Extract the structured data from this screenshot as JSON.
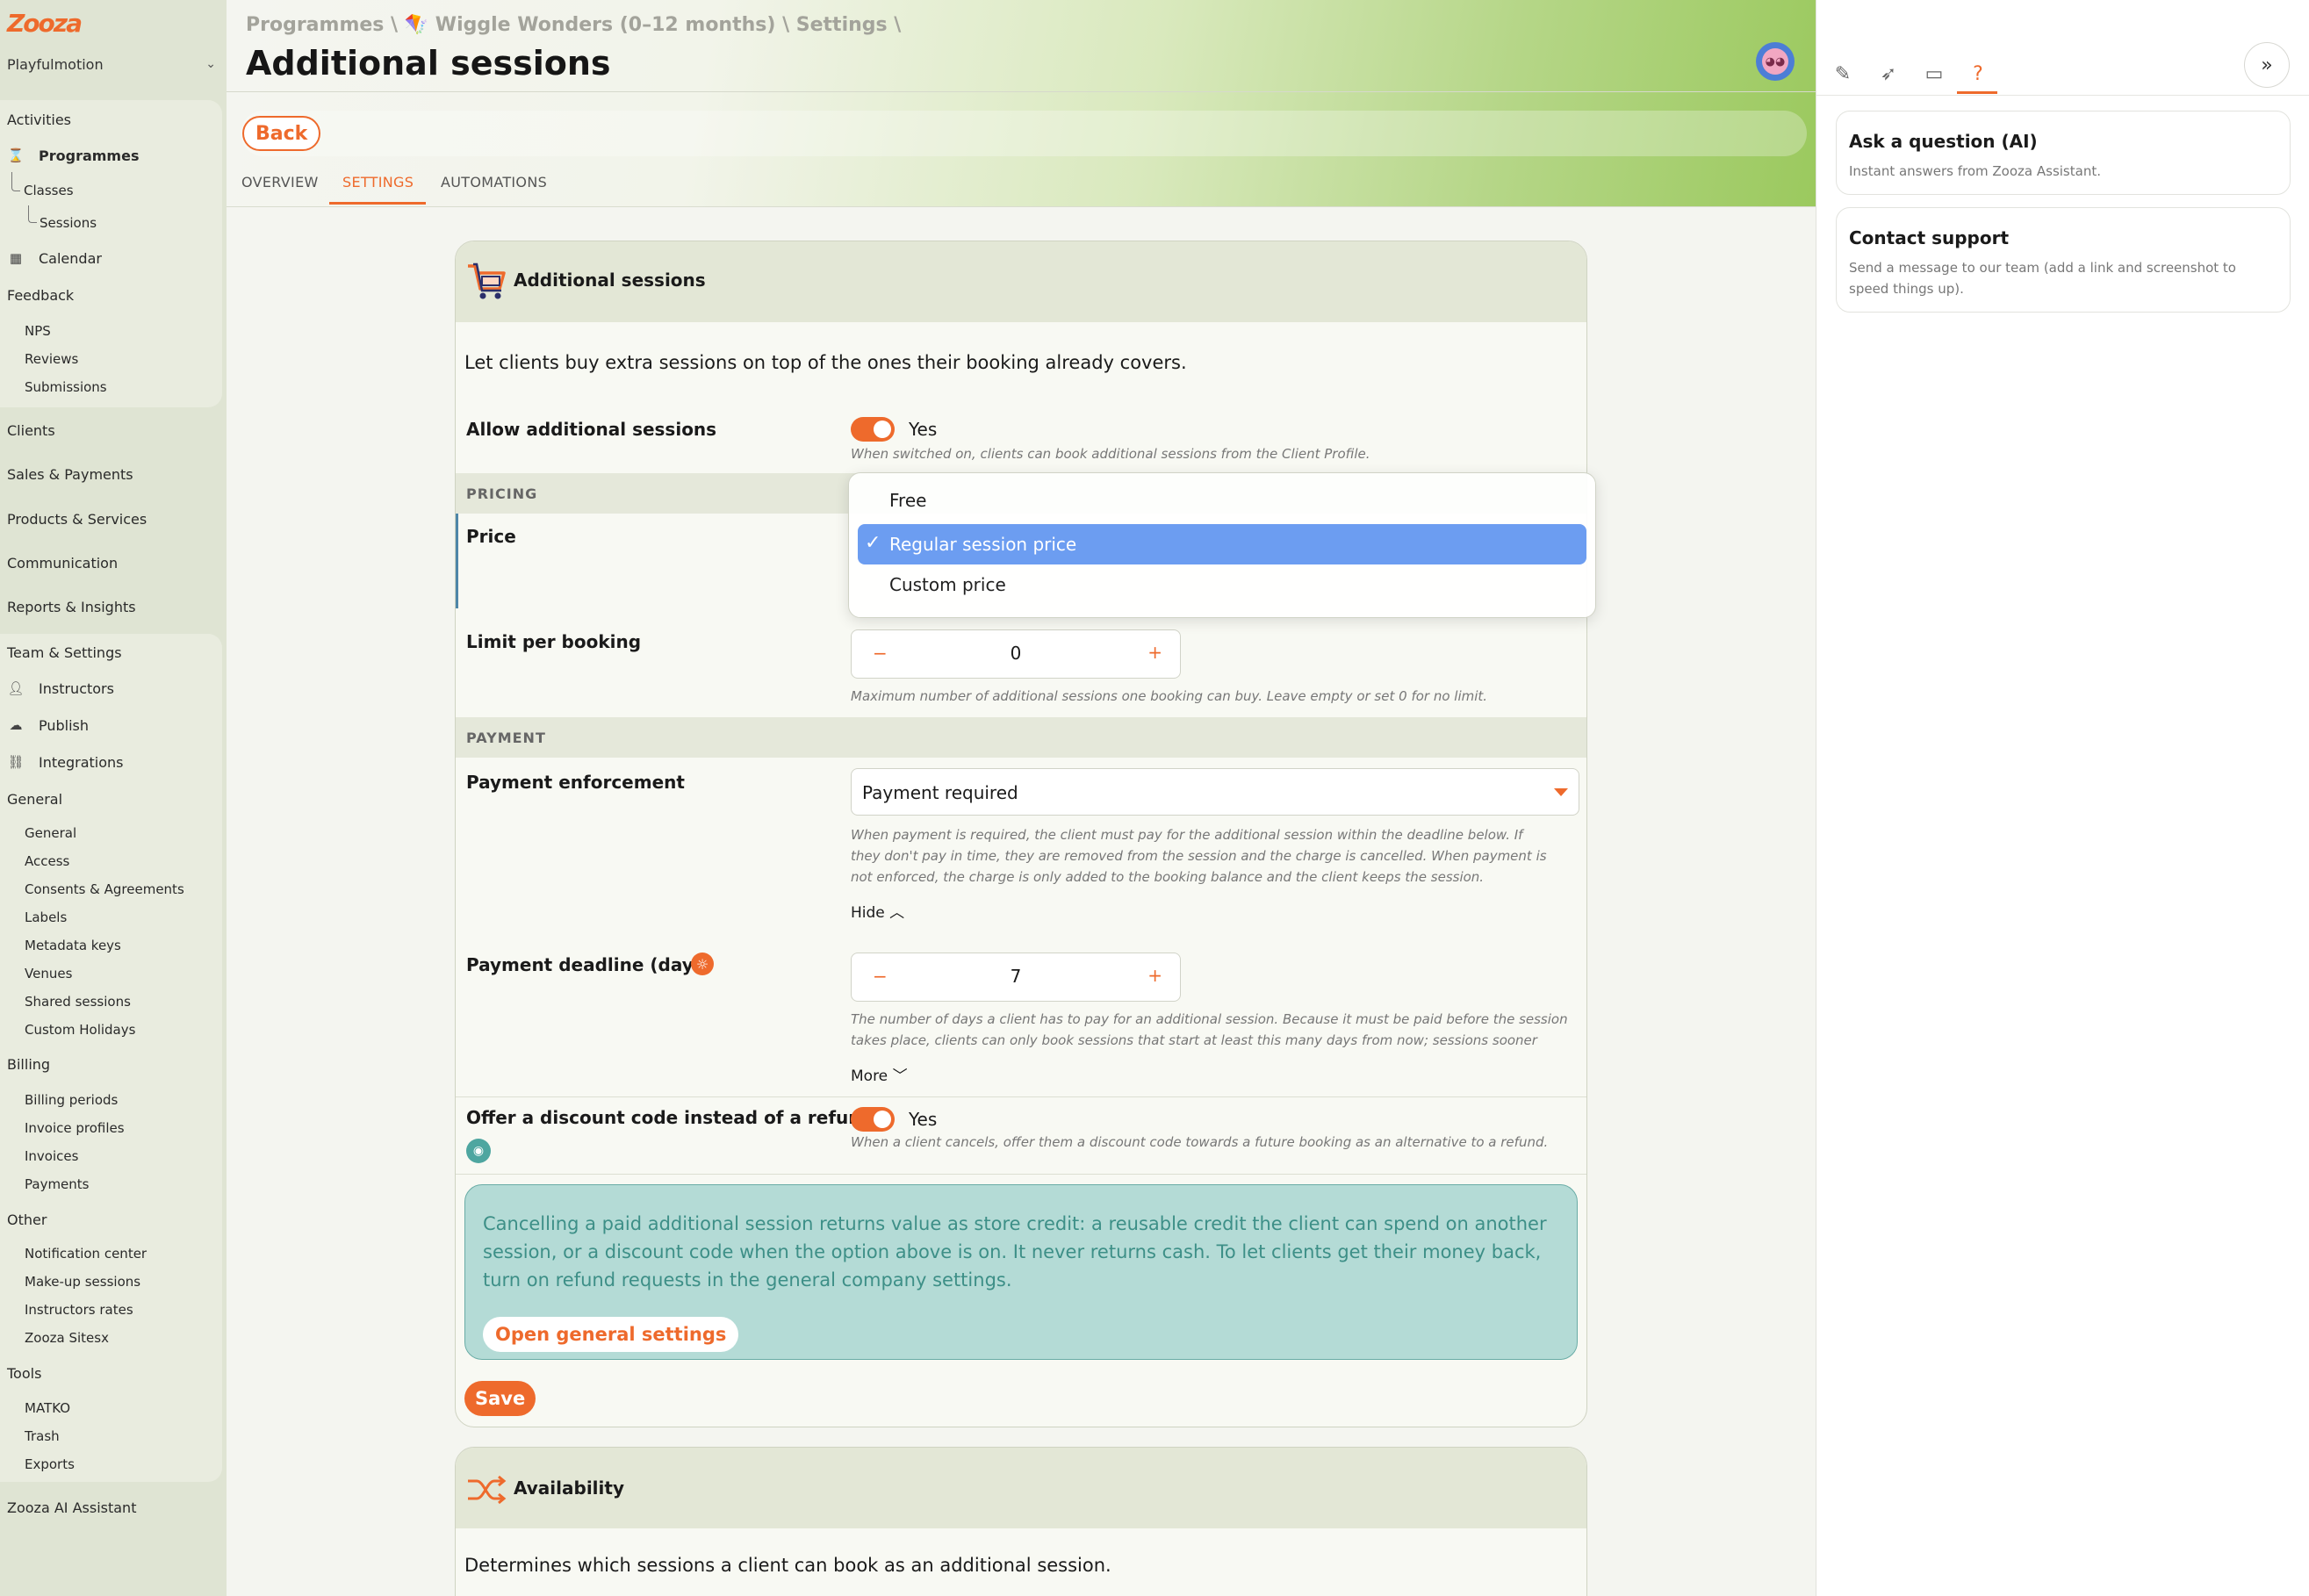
{
  "sidebar": {
    "logo": "Zooza",
    "org": "Playfulmotion",
    "items": {
      "activities": "Activities",
      "programmes": "Programmes",
      "classes": "Classes",
      "sessions": "Sessions",
      "calendar": "Calendar",
      "feedback": "Feedback",
      "nps": "NPS",
      "reviews": "Reviews",
      "submissions": "Submissions",
      "clients": "Clients",
      "sales_payments": "Sales & Payments",
      "products_services": "Products & Services",
      "communication": "Communication",
      "reports_insights": "Reports & Insights",
      "team_settings": "Team & Settings",
      "instructors": "Instructors",
      "publish": "Publish",
      "integrations": "Integrations",
      "general_header": "General",
      "general": "General",
      "access": "Access",
      "consents": "Consents & Agreements",
      "labels": "Labels",
      "metadata_keys": "Metadata keys",
      "venues": "Venues",
      "shared_sessions": "Shared sessions",
      "custom_holidays": "Custom Holidays",
      "billing": "Billing",
      "billing_periods": "Billing periods",
      "invoice_profiles": "Invoice profiles",
      "invoices": "Invoices",
      "payments": "Payments",
      "other": "Other",
      "notification_center": "Notification center",
      "makeup_sessions": "Make-up sessions",
      "instructors_rates": "Instructors rates",
      "zooza_sitesx": "Zooza Sitesx",
      "tools": "Tools",
      "matko": "MATKO",
      "trash": "Trash",
      "exports": "Exports",
      "ai_assistant": "Zooza AI Assistant"
    }
  },
  "header": {
    "breadcrumb": "Programmes \\ 🪁 Wiggle Wonders (0–12 months) \\ Settings \\",
    "title": "Additional sessions",
    "back_label": "Back",
    "tabs": [
      "OVERVIEW",
      "SETTINGS",
      "AUTOMATIONS"
    ],
    "active_tab": "SETTINGS"
  },
  "card": {
    "title": "Additional sessions",
    "intro": "Let clients buy extra sessions on top of the ones their booking already covers.",
    "allow": {
      "label": "Allow additional sessions",
      "value": "Yes",
      "hint": "When switched on, clients can book additional sessions from the Client Profile."
    },
    "pricing_section": "PRICING",
    "price": {
      "label": "Price",
      "options": [
        "Free",
        "Regular session price",
        "Custom price"
      ],
      "selected": "Regular session price"
    },
    "limit": {
      "label": "Limit per booking",
      "value": "0",
      "minus": "−",
      "plus": "+",
      "hint": "Maximum number of additional sessions one booking can buy. Leave empty or set 0 for no limit."
    },
    "payment_section": "PAYMENT",
    "enforcement": {
      "label": "Payment enforcement",
      "value": "Payment required",
      "hint": "When payment is required, the client must pay for the additional session within the deadline below. If they don't pay in time, they are removed from the session and the charge is cancelled. When payment is not enforced, the charge is only added to the booking balance and the client keeps the session.",
      "toggle": "Hide"
    },
    "deadline": {
      "label": "Payment deadline (days)",
      "value": "7",
      "minus": "−",
      "plus": "+",
      "hint": "The number of days a client has to pay for an additional session. Because it must be paid before the session takes place, clients can only book sessions that start at least this many days from now; sessions sooner than…",
      "toggle": "More"
    },
    "discount": {
      "label": "Offer a discount code instead of a refund",
      "value": "Yes",
      "hint": "When a client cancels, offer them a discount code towards a future booking as an alternative to a refund."
    },
    "info": {
      "text": "Cancelling a paid additional session returns value as store credit: a reusable credit the client can spend on another session, or a discount code when the option above is on. It never returns cash. To let clients get their money back, turn on refund requests in the general company settings.",
      "button": "Open general settings"
    },
    "save_label": "Save"
  },
  "availability": {
    "title": "Availability",
    "intro": "Determines which sessions a client can book as an additional session."
  },
  "right_panel": {
    "icons": [
      "pencil-icon",
      "rocket-icon",
      "ticket-icon",
      "question-icon"
    ],
    "ask": {
      "title": "Ask a question (AI)",
      "desc": "Instant answers from Zooza Assistant."
    },
    "support": {
      "title": "Contact support",
      "desc": "Send a message to our team (add a link and screenshot to speed things up)."
    }
  },
  "colors": {
    "accent": "#ee6a2c",
    "selection": "#6c9df1",
    "info_bg": "#b4dbd6"
  }
}
